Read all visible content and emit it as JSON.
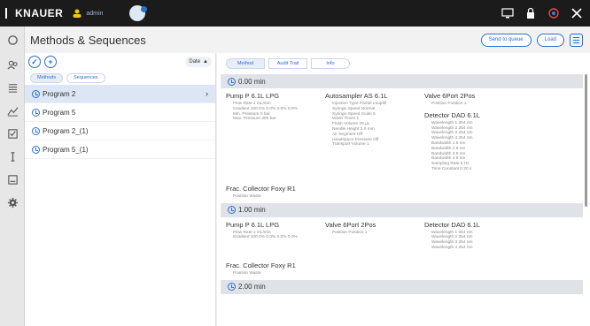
{
  "topbar": {
    "brand": "KNAUER",
    "user": "admin"
  },
  "titlebar": {
    "title": "Methods & Sequences",
    "send_to_queue": "Send to queue",
    "load": "Load"
  },
  "left": {
    "date_label": "Date",
    "tabs": [
      "Methods",
      "Sequences"
    ],
    "programs": [
      "Program 2",
      "Program 5",
      "Program 2_(1)",
      "Program 5_(1)"
    ]
  },
  "main": {
    "tabs": [
      "Method",
      "Audit Trail",
      "Info"
    ],
    "blocks": [
      {
        "time": "0.00 min",
        "row1": [
          {
            "title": "Pump P 6.1L LPG",
            "lines": [
              "Flow Rate 1 mL/min",
              "Gradient 100.0% 0.0% 0.0% 0.0%",
              "Min. Pressure 0 bar",
              "Max. Pressure 300 bar"
            ]
          },
          {
            "title": "Autosampler AS 6.1L",
            "lines": [
              "Injection Type Partial Loopfill",
              "Syringe Speed Normal",
              "Syringe Speed Scale 5",
              "Wash Times 1",
              "Flush Volume 30 µL",
              "Needle Height 2.0 mm",
              "Air Segment Off",
              "Headspace Pressure Off",
              "Transport Volume 1"
            ]
          },
          {
            "title": "Valve 6Port 2Pos",
            "lines": [
              "Position Position 1"
            ],
            "title2": "Detector DAD 6.1L",
            "lines2": [
              "Wavelength 1 254 nm",
              "Wavelength 2 254 nm",
              "Wavelength 3 254 nm",
              "Wavelength 4 254 nm",
              "Bandwidth 1 8 nm",
              "Bandwidth 2 8 nm",
              "Bandwidth 3 8 nm",
              "Bandwidth 4 8 nm",
              "Sampling Rate 5 Hz",
              "Time Constant 0.20 s"
            ]
          }
        ],
        "row2": [
          {
            "title": "Frac. Collector Foxy R1",
            "lines": [
              "Position Waste"
            ]
          }
        ]
      },
      {
        "time": "1.00 min",
        "row1": [
          {
            "title": "Pump P 6.1L LPG",
            "lines": [
              "Flow Rate 1 mL/min",
              "Gradient 100.0% 0.0% 0.0% 0.0%"
            ]
          },
          {
            "title": "Valve 6Port 2Pos",
            "lines": [
              "Position Position 1"
            ]
          },
          {
            "title": "Detector DAD 6.1L",
            "lines": [
              "Wavelength 1 254 nm",
              "Wavelength 2 254 nm",
              "Wavelength 3 254 nm",
              "Wavelength 4 254 nm"
            ]
          }
        ],
        "row2": [
          {
            "title": "Frac. Collector Foxy R1",
            "lines": [
              "Position Waste"
            ]
          }
        ]
      },
      {
        "time": "2.00 min"
      }
    ]
  }
}
